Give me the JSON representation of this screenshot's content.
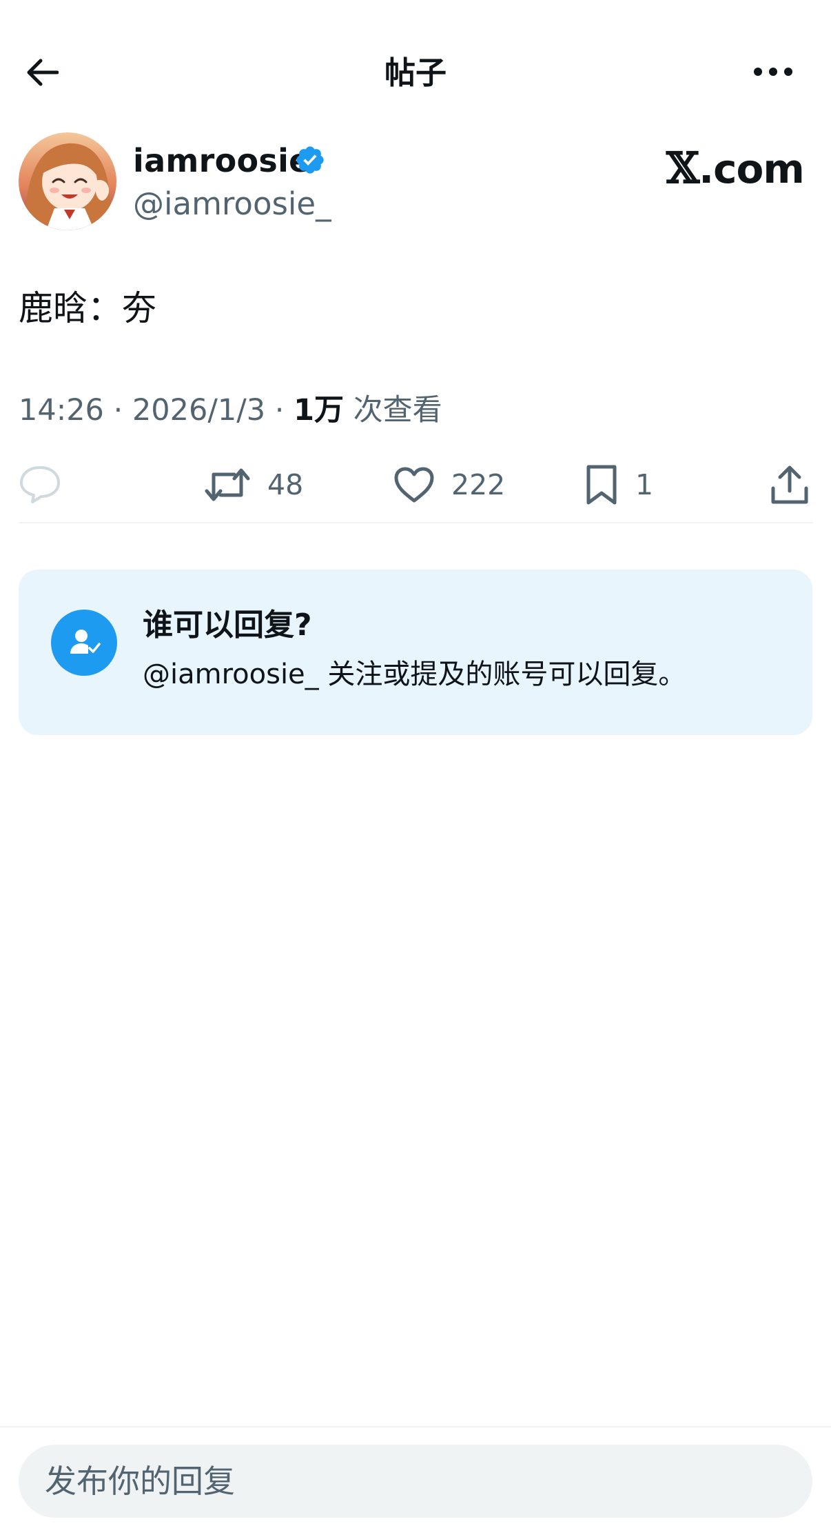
{
  "header": {
    "title": "帖子",
    "back_icon": "arrow-left-icon",
    "more_icon": "more-horizontal-icon"
  },
  "author": {
    "display_name": "iamroosie",
    "handle": "@iamroosie_",
    "verified": true,
    "verified_color": "#1d9bf0"
  },
  "watermark": {
    "x": "𝕏",
    "domain": ".com"
  },
  "post": {
    "text": "鹿晗：夯",
    "time": "14:26",
    "date": "2026/1/3",
    "views_count": "1万",
    "views_label": "次查看"
  },
  "actions": {
    "reply": {
      "icon": "reply-icon",
      "count": ""
    },
    "retweet": {
      "icon": "retweet-icon",
      "count": "48"
    },
    "like": {
      "icon": "heart-icon",
      "count": "222"
    },
    "bookmark": {
      "icon": "bookmark-icon",
      "count": "1"
    },
    "share": {
      "icon": "share-icon"
    }
  },
  "reply_info": {
    "title": "谁可以回复?",
    "description": "@iamroosie_ 关注或提及的账号可以回复。",
    "icon": "user-check-icon"
  },
  "composer": {
    "placeholder": "发布你的回复"
  },
  "colors": {
    "accent": "#1d9bf0",
    "text": "#0f1419",
    "secondary_text": "#536471",
    "info_background": "#e8f5fd"
  }
}
